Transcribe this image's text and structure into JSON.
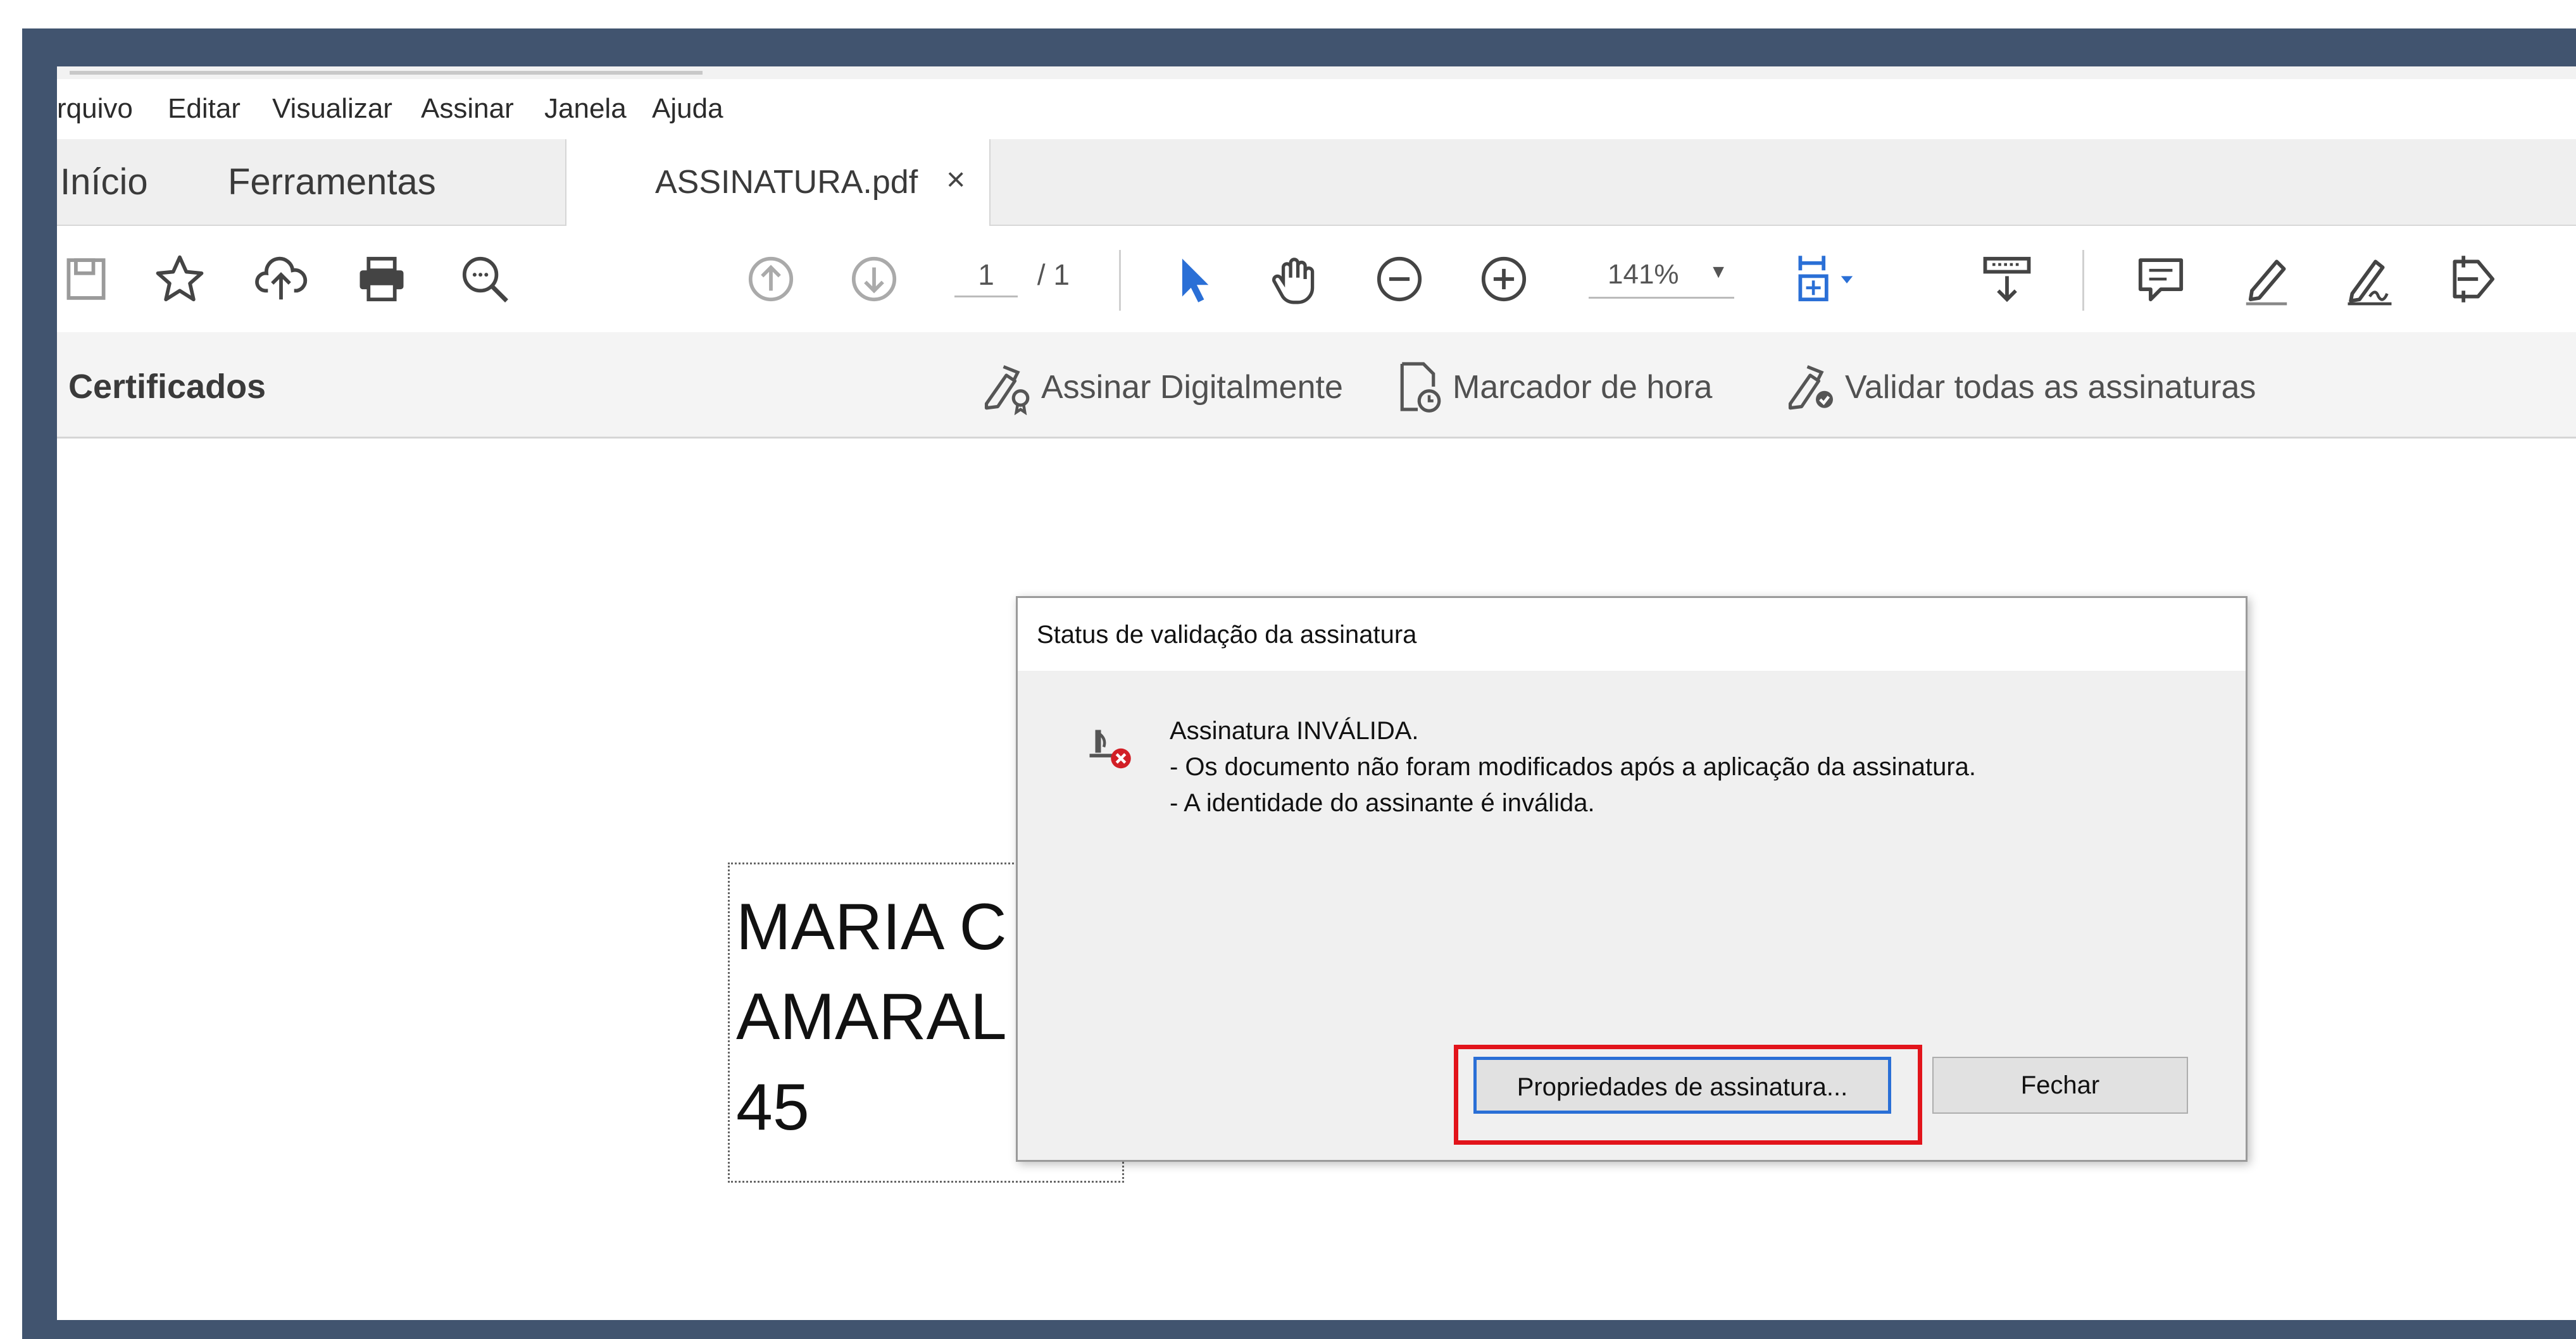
{
  "menu": {
    "items": [
      "rquivo",
      "Editar",
      "Visualizar",
      "Assinar",
      "Janela",
      "Ajuda"
    ]
  },
  "tabs": {
    "home": "Início",
    "tools": "Ferramentas",
    "document": "ASSINATURA.pdf",
    "close_symbol": "×"
  },
  "toolbar": {
    "page_current": "1",
    "page_total": "/ 1",
    "zoom": "141%",
    "icons": [
      "save-icon",
      "star-icon",
      "upload-cloud-icon",
      "print-icon",
      "search-icon",
      "page-up-icon",
      "page-down-icon",
      "select-arrow-icon",
      "hand-icon",
      "zoom-out-icon",
      "zoom-in-icon",
      "fit-page-icon",
      "scroll-mode-icon",
      "comment-icon",
      "highlight-pen-icon",
      "sign-icon",
      "share-icon"
    ]
  },
  "certificates": {
    "title": "Certificados",
    "sign_digitally": "Assinar Digitalmente",
    "timestamp": "Marcador de hora",
    "validate_all": "Validar todas as assinaturas"
  },
  "document": {
    "signature_lines": [
      "MARIA C",
      "AMARAL",
      "45"
    ]
  },
  "dialog": {
    "title": "Status de validação da assinatura",
    "line1": "Assinatura INVÁLIDA.",
    "line2": "- Os documento não foram modificados após a aplicação da assinatura.",
    "line3": "- A identidade do assinante é inválida.",
    "properties_button": "Propriedades de assinatura...",
    "close_button": "Fechar"
  },
  "colors": {
    "frame": "#41546f",
    "accent_blue": "#2a6fd6",
    "highlight_red": "#e2141b"
  }
}
